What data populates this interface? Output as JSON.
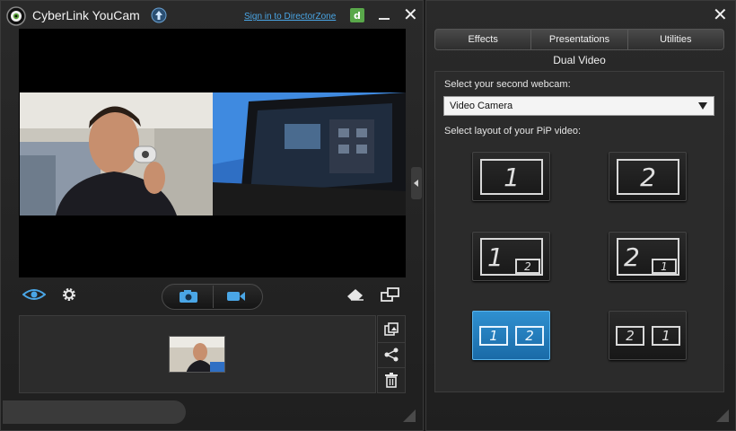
{
  "app": {
    "title": "CyberLink YouCam",
    "director_zone_link": "Sign in to DirectorZone"
  },
  "left_toolbar": {
    "tools": [
      "eye-icon",
      "gear-icon"
    ],
    "capture_modes": [
      "camera-icon",
      "video-camera-icon"
    ],
    "right_tools": [
      "eraser-icon",
      "window-switch-icon"
    ]
  },
  "gallery": {
    "tools": [
      "layers-icon",
      "share-icon",
      "trash-icon"
    ]
  },
  "right_panel": {
    "tabs": [
      "Effects",
      "Presentations",
      "Utilities"
    ],
    "section_title": "Dual Video",
    "webcam_label": "Select your second webcam:",
    "webcam_value": "Video Camera",
    "layout_label": "Select layout of your PiP video:",
    "layouts": [
      {
        "main": "1",
        "pip": ""
      },
      {
        "main": "2",
        "pip": ""
      },
      {
        "main": "1",
        "pip": "2"
      },
      {
        "main": "2",
        "pip": "1"
      },
      {
        "main": "1",
        "pip": "2",
        "selected": true
      },
      {
        "main": "2",
        "pip": "1"
      }
    ]
  },
  "colors": {
    "accent": "#2f90d0",
    "link": "#4aa6e6"
  }
}
